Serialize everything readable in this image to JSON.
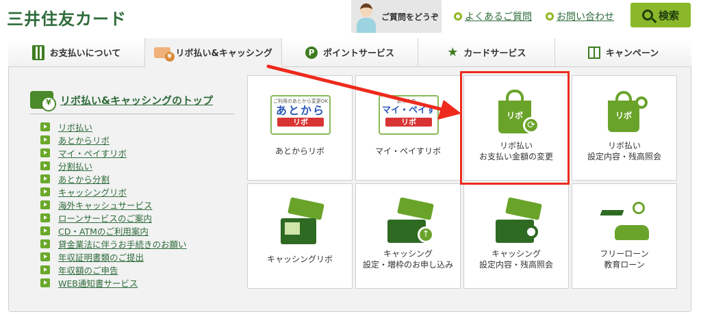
{
  "header": {
    "logo": "三井住友カード",
    "help_banner": "ご質問をどうぞ",
    "links": [
      {
        "label": "よくあるご質問"
      },
      {
        "label": "お問い合わせ"
      }
    ],
    "search_label": "検索"
  },
  "nav": {
    "tabs": [
      {
        "label": "お支払いについて",
        "icon": "calculator-icon"
      },
      {
        "label": "リボ払い&キャッシング",
        "icon": "card-yen-icon"
      },
      {
        "label": "ポイントサービス",
        "icon": "point-icon"
      },
      {
        "label": "カードサービス",
        "icon": "star-icon"
      },
      {
        "label": "キャンペーン",
        "icon": "gift-icon"
      }
    ],
    "point_glyph": "P",
    "star_glyph": "★"
  },
  "sidebar": {
    "title": "リボ払い&キャッシングのトップ",
    "items": [
      "リボ払い",
      "あとからリボ",
      "マイ・ペイすリボ",
      "分割払い",
      "あとから分割",
      "キャッシングリボ",
      "海外キャッシュサービス",
      "ローンサービスのご案内",
      "CD・ATMのご利用案内",
      "貸金業法に伴うお手続きのお願い",
      "年収証明書類のご提出",
      "年収額のご申告",
      "WEB通知書サービス"
    ]
  },
  "tiles": {
    "atokara": {
      "label": "あとからリボ",
      "logo_small": "ご利用のあとから変更OK",
      "logo_big": "あとから",
      "logo_bar": "リボ"
    },
    "mypay": {
      "label": "マイ・ペイすリボ",
      "logo_small": "あなたの…",
      "logo_big": "マイ・ペイす",
      "logo_bar": "リボ"
    },
    "change": {
      "line1": "リボ払い",
      "line2": "お支払い金額の変更",
      "bag_text": "リボ"
    },
    "inquiry": {
      "line1": "リボ払い",
      "line2": "設定内容・残高照会",
      "bag_text": "リボ"
    },
    "cashing_revo": {
      "label": "キャッシングリボ"
    },
    "cashing_apply": {
      "line1": "キャッシング",
      "line2": "設定・増枠のお申し込み"
    },
    "cashing_inquiry": {
      "line1": "キャッシング",
      "line2": "設定内容・残高照会"
    },
    "free_loan": {
      "line1": "フリーローン",
      "line2": "教育ローン"
    }
  },
  "colors": {
    "brand_green": "#2e6b3a",
    "accent_green": "#8ab82a",
    "highlight_red": "#ee2a1c"
  }
}
